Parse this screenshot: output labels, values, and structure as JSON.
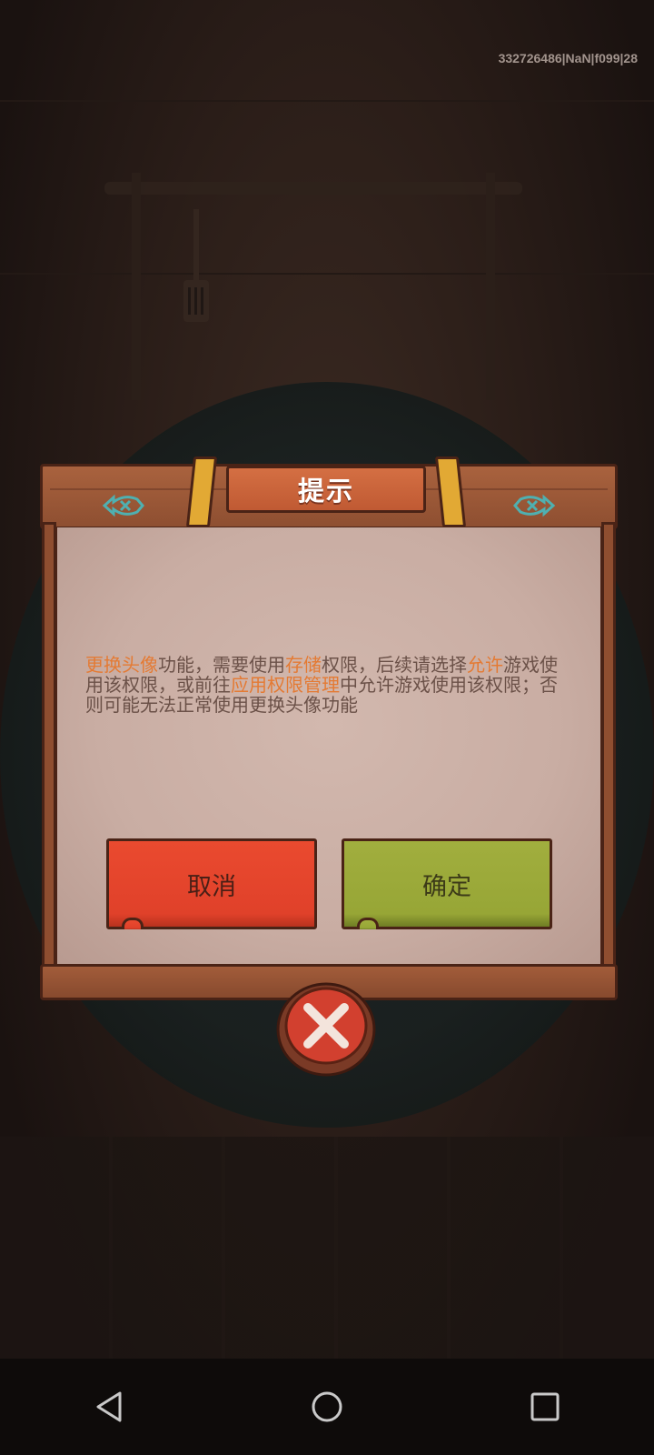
{
  "overlay": {
    "debug_info": "332726486|NaN|f099|28"
  },
  "dialog": {
    "title": "提示",
    "message": {
      "part1_highlight": "更换头像",
      "part2": "功能，需要使用",
      "part3_highlight": "存储",
      "part4": "权限，后续请选择",
      "part5_highlight": "允许",
      "part6": "游戏使用该权限，或前往",
      "part7_highlight": "应用权限管理",
      "part8": "中允许游戏使用该权限；否则可能无法正常使用更换头像功能"
    },
    "cancel_label": "取消",
    "confirm_label": "确定",
    "close_icon": "close-x-icon"
  },
  "navbar": {
    "back_icon": "back-triangle-icon",
    "home_icon": "home-circle-icon",
    "recents_icon": "recents-square-icon"
  },
  "colors": {
    "highlight": "#e47a33",
    "cancel_button": "#e0412a",
    "confirm_button": "#97a636",
    "title_plate": "#c9633a"
  }
}
